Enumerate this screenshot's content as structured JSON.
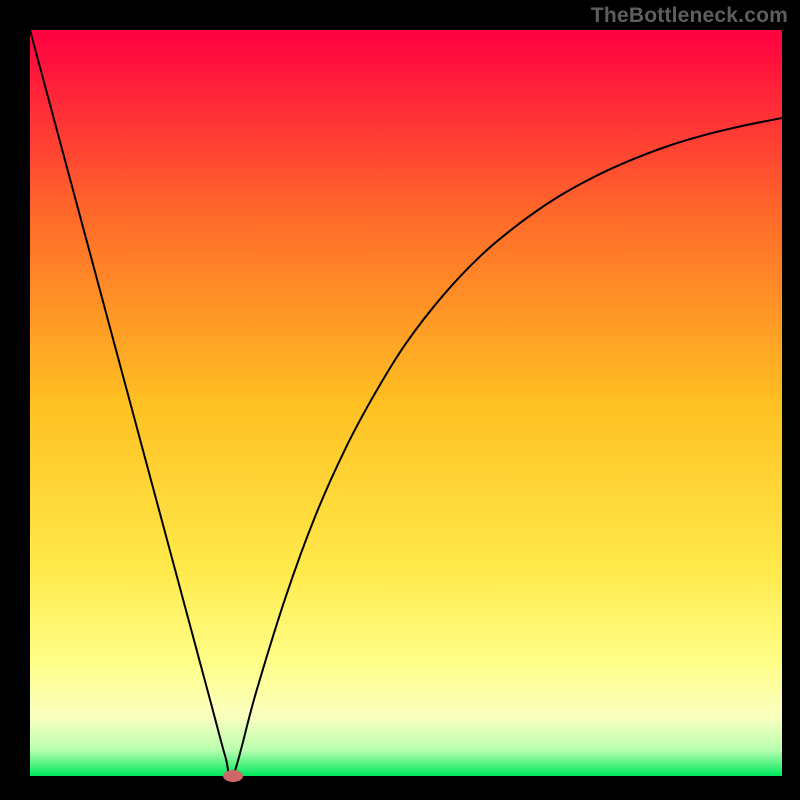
{
  "watermark": "TheBottleneck.com",
  "chart_data": {
    "type": "line",
    "title": "",
    "xlabel": "",
    "ylabel": "",
    "xlim": [
      0,
      100
    ],
    "ylim": [
      0,
      100
    ],
    "grid": false,
    "legend": false,
    "annotations": [],
    "background_gradient": {
      "direction": "vertical",
      "stops": [
        {
          "pos": 0.0,
          "color": "#ff0040"
        },
        {
          "pos": 0.25,
          "color": "#ff6a2a"
        },
        {
          "pos": 0.5,
          "color": "#ffc022"
        },
        {
          "pos": 0.72,
          "color": "#ffe94a"
        },
        {
          "pos": 0.85,
          "color": "#ffff8a"
        },
        {
          "pos": 0.92,
          "color": "#fbffc0"
        },
        {
          "pos": 0.965,
          "color": "#b9ffb0"
        },
        {
          "pos": 1.0,
          "color": "#00e85e"
        }
      ]
    },
    "series": [
      {
        "name": "bottleneck-curve",
        "color": "#000000",
        "x": [
          0,
          2,
          4,
          6,
          8,
          10,
          12,
          14,
          16,
          18,
          20,
          22,
          24,
          26,
          27,
          30,
          34,
          38,
          42,
          46,
          50,
          55,
          60,
          65,
          70,
          75,
          80,
          85,
          90,
          95,
          100
        ],
        "y": [
          100,
          92.5,
          85,
          77.5,
          70,
          62.5,
          55,
          47.5,
          40,
          32.5,
          25,
          17.5,
          10,
          2.5,
          0,
          11,
          24,
          35,
          44,
          51.5,
          58,
          64.5,
          69.8,
          74,
          77.5,
          80.3,
          82.6,
          84.5,
          86,
          87.2,
          88.2
        ]
      }
    ],
    "marker": {
      "name": "optimal-point",
      "x": 27,
      "y": 0,
      "color": "#cc6868",
      "shape": "ellipse"
    }
  },
  "layout": {
    "outer_w": 800,
    "outer_h": 800,
    "border_left": 30,
    "border_right": 18,
    "border_top": 30,
    "border_bottom": 24
  }
}
